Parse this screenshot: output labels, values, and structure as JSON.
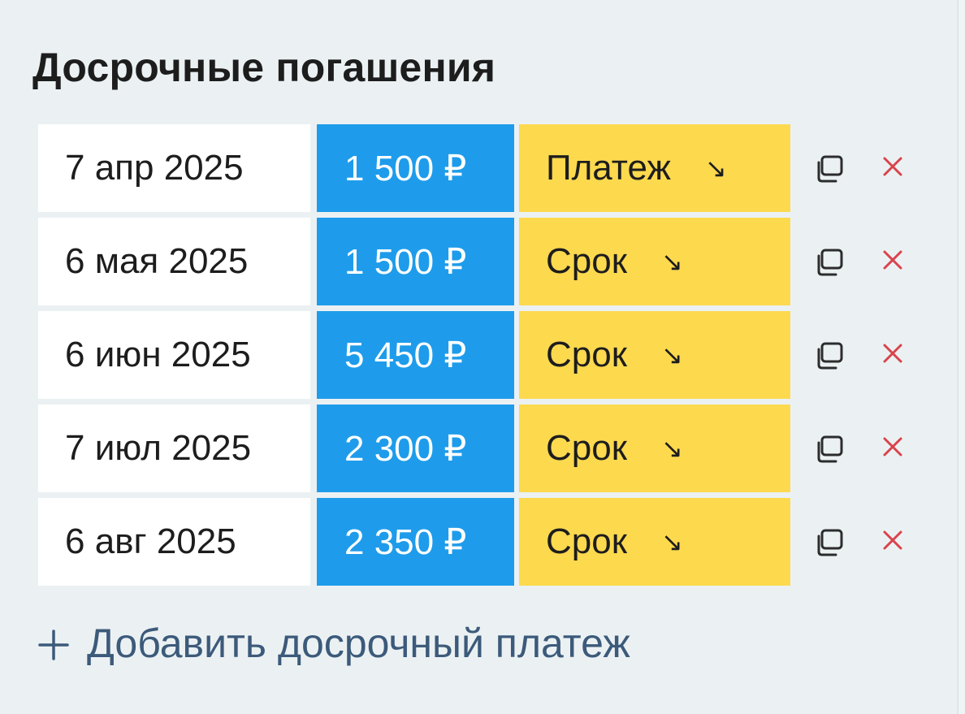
{
  "section": {
    "title": "Досрочные погашения"
  },
  "payments": [
    {
      "date": "7 апр 2025",
      "amount": "1 500 ₽",
      "type": "Платеж",
      "type_icon": "arrow-down-right-icon"
    },
    {
      "date": "6 мая 2025",
      "amount": "1 500 ₽",
      "type": "Срок",
      "type_icon": "arrow-down-right-icon"
    },
    {
      "date": "6 июн 2025",
      "amount": "5 450 ₽",
      "type": "Срок",
      "type_icon": "arrow-down-right-icon"
    },
    {
      "date": "7 июл 2025",
      "amount": "2 300 ₽",
      "type": "Срок",
      "type_icon": "arrow-down-right-icon"
    },
    {
      "date": "6 авг 2025",
      "amount": "2 350 ₽",
      "type": "Срок",
      "type_icon": "arrow-down-right-icon"
    }
  ],
  "row_actions": {
    "copy_icon": "copy-icon",
    "delete_icon": "close-icon"
  },
  "add_button": {
    "icon": "plus-icon",
    "label": "Добавить досрочный платеж"
  },
  "colors": {
    "background": "#ebf1f3",
    "date_cell": "#ffffff",
    "amount_cell": "#1e9ceb",
    "type_cell": "#fdd94e",
    "delete_accent": "#d9434b",
    "link": "#3c5a7a"
  }
}
